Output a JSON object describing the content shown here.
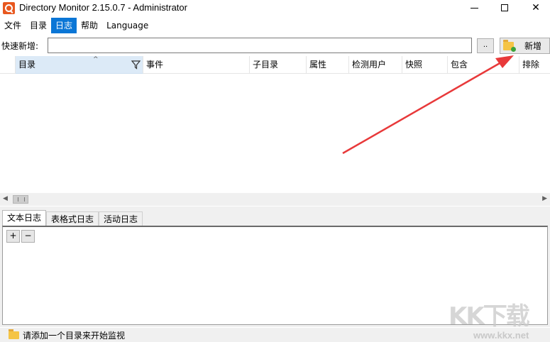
{
  "window": {
    "title": "Directory Monitor 2.15.0.7 - Administrator",
    "minimize_glyph": "",
    "close_glyph": "✕"
  },
  "menu": {
    "items": [
      {
        "label": "文件",
        "active": false
      },
      {
        "label": "目录",
        "active": false
      },
      {
        "label": "日志",
        "active": true
      },
      {
        "label": "帮助",
        "active": false
      },
      {
        "label": "Language",
        "active": false
      }
    ]
  },
  "quick_add": {
    "label": "快速新增:",
    "input_value": "",
    "browse_label": "..",
    "add_button_label": "新增"
  },
  "columns": [
    "目录",
    "事件",
    "子目录",
    "属性",
    "检测用户",
    "快照",
    "包含",
    "排除"
  ],
  "sorted_column": "目录",
  "log_tabs": [
    {
      "label": "文本日志",
      "active": true
    },
    {
      "label": "表格式日志",
      "active": false
    },
    {
      "label": "活动日志",
      "active": false
    }
  ],
  "log_buttons": {
    "expand": "+",
    "collapse": "−"
  },
  "status": {
    "text": "请添加一个目录来开始监视"
  },
  "watermark": {
    "logo": "KK下载",
    "url": "www.kkx.net"
  },
  "colors": {
    "menu_active_bg": "#0a76d6",
    "app_icon": "#e8581f",
    "annotation_arrow": "#e8393a",
    "sorted_column_bg": "#dceaf7"
  },
  "icons": [
    "app-icon",
    "folder-add-icon",
    "filter-icon",
    "sort-up-icon",
    "folder-icon",
    "scroll-left-icon",
    "scroll-right-icon"
  ]
}
